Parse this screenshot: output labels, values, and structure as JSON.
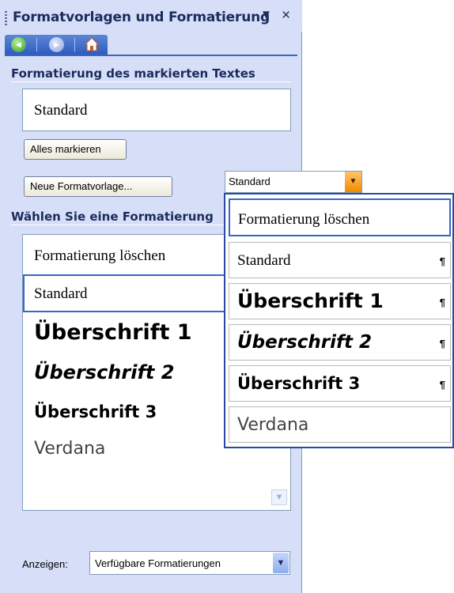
{
  "pane": {
    "title": "Formatvorlagen und Formatierung",
    "dropdown_glyph": "▼",
    "close_glyph": "×"
  },
  "nav": {
    "back_icon": "back-arrow-icon",
    "forward_icon": "forward-arrow-icon",
    "home_icon": "home-icon"
  },
  "selected_section": {
    "heading": "Formatierung des markierten Textes",
    "current_format": "Standard",
    "select_all_label": "Alles markieren",
    "new_style_label": "Neue Formatvorlage..."
  },
  "choose_section": {
    "heading": "Wählen Sie eine Formatierung",
    "items": [
      {
        "label": "Formatierung löschen"
      },
      {
        "label": "Standard"
      },
      {
        "label": "Überschrift 1"
      },
      {
        "label": "Überschrift 2"
      },
      {
        "label": "Überschrift 3"
      },
      {
        "label": "Verdana"
      }
    ]
  },
  "footer": {
    "show_label": "Anzeigen:",
    "show_value": "Verfügbare Formatierungen"
  },
  "style_combo": {
    "value": "Standard",
    "options": [
      {
        "label": "Formatierung löschen",
        "mark": ""
      },
      {
        "label": "Standard",
        "mark": "¶"
      },
      {
        "label": "Überschrift 1",
        "mark": "¶"
      },
      {
        "label": "Überschrift 2",
        "mark": "¶"
      },
      {
        "label": "Überschrift 3",
        "mark": "¶"
      },
      {
        "label": "Verdana",
        "mark": ""
      }
    ]
  },
  "colors": {
    "pane_bg": "#d6dff7",
    "accent_blue": "#3a65c4",
    "combo_arrow_orange": "#f08a00"
  }
}
